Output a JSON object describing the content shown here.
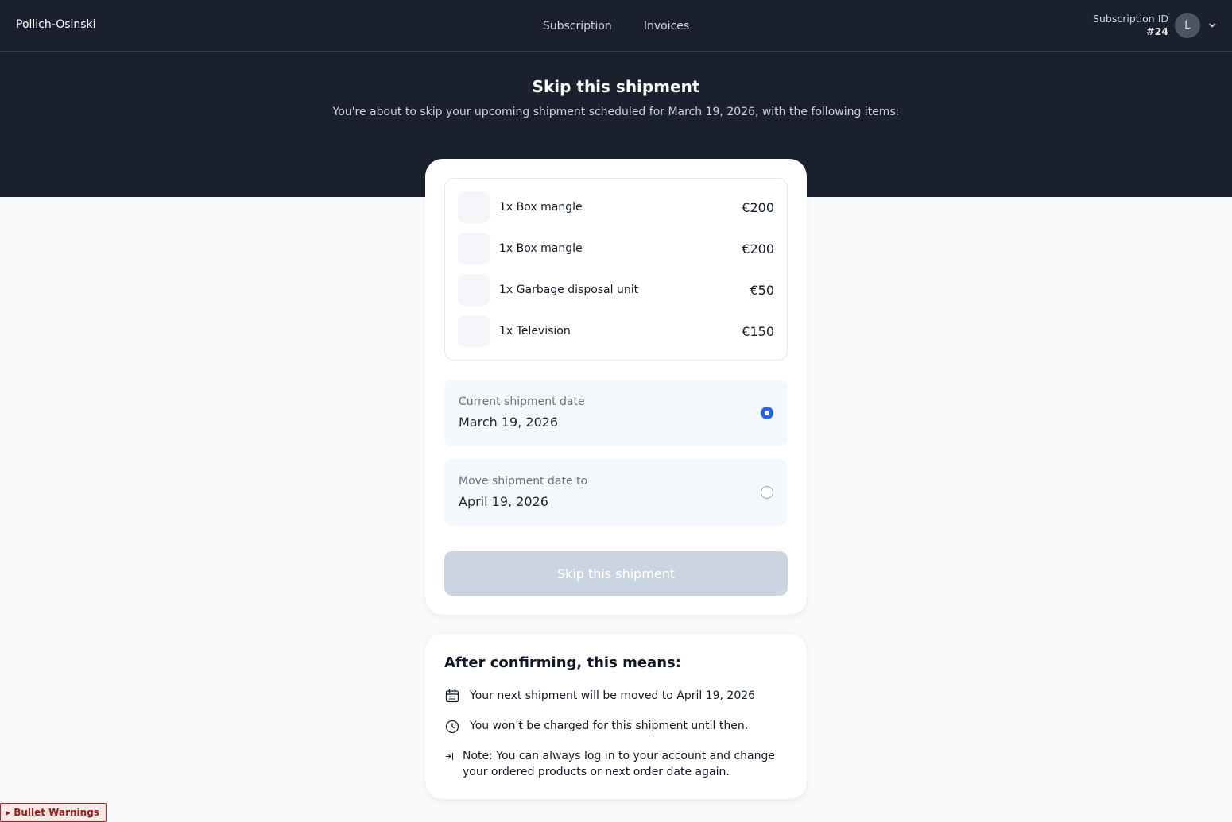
{
  "header": {
    "brand": "Pollich-Osinski",
    "nav": [
      "Subscription",
      "Invoices"
    ],
    "subscription_id_label": "Subscription ID",
    "subscription_id_value": "#24",
    "avatar_initial": "L"
  },
  "hero": {
    "title": "Skip this shipment",
    "subtitle": "You're about to skip your upcoming shipment scheduled for March 19, 2026, with the following items:"
  },
  "items": [
    {
      "name": "1x Box mangle",
      "price": "€200"
    },
    {
      "name": "1x Box mangle",
      "price": "€200"
    },
    {
      "name": "1x Garbage disposal unit",
      "price": "€50"
    },
    {
      "name": "1x Television",
      "price": "€150"
    }
  ],
  "options": {
    "current": {
      "label": "Current shipment date",
      "value": "March 19, 2026",
      "selected": true
    },
    "move": {
      "label": "Move shipment date to",
      "value": "April 19, 2026",
      "selected": false
    }
  },
  "skip_button": "Skip this shipment",
  "info": {
    "title": "After confirming, this means:",
    "rows": [
      "Your next shipment will be moved to April 19, 2026",
      "You won't be charged for this shipment until then.",
      "Note: You can always log in to your account and change your ordered products or next order date again."
    ]
  },
  "warnings_toggle": "▸ Bullet Warnings",
  "colors": {
    "header_bg": "#1b202e",
    "accent": "#2563eb",
    "disabled_button": "#cbd5e1"
  }
}
